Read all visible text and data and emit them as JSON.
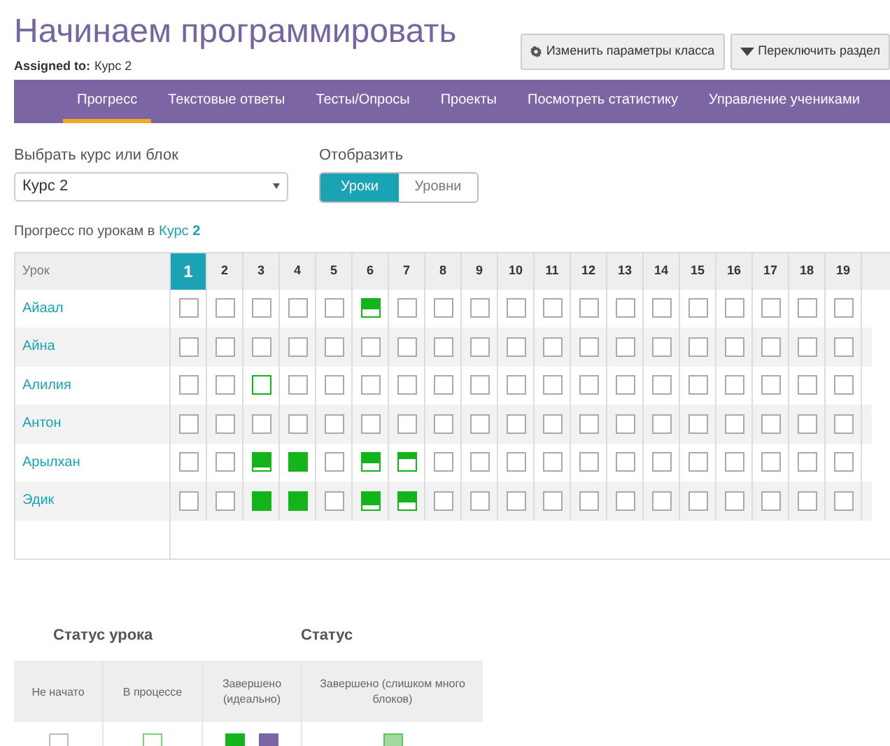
{
  "title": "Начинаем программировать",
  "assigned": {
    "label": "Assigned to:",
    "value": "Курс 2"
  },
  "buttons": [
    {
      "kind": "gear",
      "label": "Изменить параметры класса"
    },
    {
      "kind": "caret",
      "label": "Переключить раздел"
    }
  ],
  "tabs": [
    {
      "label": "Прогресс",
      "selected": true
    },
    {
      "label": "Текстовые ответы",
      "selected": false
    },
    {
      "label": "Тесты/Опросы",
      "selected": false
    },
    {
      "label": "Проекты",
      "selected": false
    },
    {
      "label": "Посмотреть статистику",
      "selected": false
    },
    {
      "label": "Управление учениками",
      "selected": false
    }
  ],
  "course_select": {
    "label": "Выбрать курс или блок",
    "value": "Курс 2"
  },
  "display": {
    "label": "Отобразить",
    "options": [
      {
        "label": "Уроки",
        "selected": true
      },
      {
        "label": "Уровни",
        "selected": false
      }
    ]
  },
  "progress_caption": {
    "text": "Прогресс по урокам в ",
    "link": "Курс **2**"
  },
  "table": {
    "header": "Урок",
    "lessons": [
      {
        "label": "1",
        "selected": true
      },
      {
        "label": "2",
        "selected": false
      },
      {
        "label": "3",
        "selected": false
      },
      {
        "label": "4",
        "selected": false
      },
      {
        "label": "5",
        "selected": false
      },
      {
        "label": "6",
        "selected": false
      },
      {
        "label": "7",
        "selected": false
      },
      {
        "label": "8",
        "selected": false
      },
      {
        "label": "9",
        "selected": false
      },
      {
        "label": "10",
        "selected": false
      },
      {
        "label": "11",
        "selected": false
      },
      {
        "label": "12",
        "selected": false
      },
      {
        "label": "13",
        "selected": false
      },
      {
        "label": "14",
        "selected": false
      },
      {
        "label": "15",
        "selected": false
      },
      {
        "label": "16",
        "selected": false
      },
      {
        "label": "17",
        "selected": false
      },
      {
        "label": "18",
        "selected": false
      },
      {
        "label": "19",
        "selected": false
      }
    ],
    "students": [
      {
        "name": "Айаал",
        "cells": [
          {
            "kind": "empty"
          },
          {
            "kind": "empty"
          },
          {
            "kind": "empty"
          },
          {
            "kind": "empty"
          },
          {
            "kind": "empty"
          },
          {
            "kind": "mid"
          },
          {
            "kind": "empty"
          },
          {
            "kind": "empty"
          },
          {
            "kind": "empty"
          },
          {
            "kind": "empty"
          },
          {
            "kind": "empty"
          },
          {
            "kind": "empty"
          },
          {
            "kind": "empty"
          },
          {
            "kind": "empty"
          },
          {
            "kind": "empty"
          },
          {
            "kind": "empty"
          },
          {
            "kind": "empty"
          },
          {
            "kind": "empty"
          },
          {
            "kind": "empty"
          }
        ]
      },
      {
        "name": "Айна",
        "cells": [
          {
            "kind": "empty"
          },
          {
            "kind": "empty"
          },
          {
            "kind": "empty"
          },
          {
            "kind": "empty"
          },
          {
            "kind": "empty"
          },
          {
            "kind": "empty"
          },
          {
            "kind": "empty"
          },
          {
            "kind": "empty"
          },
          {
            "kind": "empty"
          },
          {
            "kind": "empty"
          },
          {
            "kind": "empty"
          },
          {
            "kind": "empty"
          },
          {
            "kind": "empty"
          },
          {
            "kind": "empty"
          },
          {
            "kind": "empty"
          },
          {
            "kind": "empty"
          },
          {
            "kind": "empty"
          },
          {
            "kind": "empty"
          },
          {
            "kind": "empty"
          }
        ]
      },
      {
        "name": "Алилия",
        "cells": [
          {
            "kind": "empty"
          },
          {
            "kind": "empty"
          },
          {
            "kind": "started"
          },
          {
            "kind": "empty"
          },
          {
            "kind": "empty"
          },
          {
            "kind": "empty"
          },
          {
            "kind": "empty"
          },
          {
            "kind": "empty"
          },
          {
            "kind": "empty"
          },
          {
            "kind": "empty"
          },
          {
            "kind": "empty"
          },
          {
            "kind": "empty"
          },
          {
            "kind": "empty"
          },
          {
            "kind": "empty"
          },
          {
            "kind": "empty"
          },
          {
            "kind": "empty"
          },
          {
            "kind": "empty"
          },
          {
            "kind": "empty"
          },
          {
            "kind": "empty"
          }
        ]
      },
      {
        "name": "Антон",
        "cells": [
          {
            "kind": "empty"
          },
          {
            "kind": "empty"
          },
          {
            "kind": "empty"
          },
          {
            "kind": "empty"
          },
          {
            "kind": "empty"
          },
          {
            "kind": "empty"
          },
          {
            "kind": "empty"
          },
          {
            "kind": "empty"
          },
          {
            "kind": "empty"
          },
          {
            "kind": "empty"
          },
          {
            "kind": "empty"
          },
          {
            "kind": "empty"
          },
          {
            "kind": "empty"
          },
          {
            "kind": "empty"
          },
          {
            "kind": "empty"
          },
          {
            "kind": "empty"
          },
          {
            "kind": "empty"
          },
          {
            "kind": "empty"
          },
          {
            "kind": "empty"
          }
        ]
      },
      {
        "name": "Арылхан",
        "cells": [
          {
            "kind": "empty"
          },
          {
            "kind": "empty"
          },
          {
            "kind": "high"
          },
          {
            "kind": "full"
          },
          {
            "kind": "empty"
          },
          {
            "kind": "mid"
          },
          {
            "kind": "low"
          },
          {
            "kind": "empty"
          },
          {
            "kind": "empty"
          },
          {
            "kind": "empty"
          },
          {
            "kind": "empty"
          },
          {
            "kind": "empty"
          },
          {
            "kind": "empty"
          },
          {
            "kind": "empty"
          },
          {
            "kind": "empty"
          },
          {
            "kind": "empty"
          },
          {
            "kind": "empty"
          },
          {
            "kind": "empty"
          },
          {
            "kind": "empty"
          }
        ]
      },
      {
        "name": "Эдик",
        "cells": [
          {
            "kind": "empty"
          },
          {
            "kind": "empty"
          },
          {
            "kind": "full"
          },
          {
            "kind": "full"
          },
          {
            "kind": "empty"
          },
          {
            "kind": "high"
          },
          {
            "kind": "mid"
          },
          {
            "kind": "empty"
          },
          {
            "kind": "empty"
          },
          {
            "kind": "empty"
          },
          {
            "kind": "empty"
          },
          {
            "kind": "empty"
          },
          {
            "kind": "empty"
          },
          {
            "kind": "empty"
          },
          {
            "kind": "empty"
          },
          {
            "kind": "empty"
          },
          {
            "kind": "empty"
          },
          {
            "kind": "empty"
          },
          {
            "kind": "empty"
          }
        ]
      }
    ]
  },
  "legend": {
    "headings": [
      "Статус урока",
      "Статус"
    ],
    "columns": [
      {
        "label": "Не начато",
        "kind": "empty"
      },
      {
        "label": "В процессе",
        "kind": "started"
      },
      {
        "label": "Завершено (идеально)",
        "kind": "perfect"
      },
      {
        "label": "Завершено (слишком много блоков)",
        "kind": "too_many"
      }
    ]
  }
}
